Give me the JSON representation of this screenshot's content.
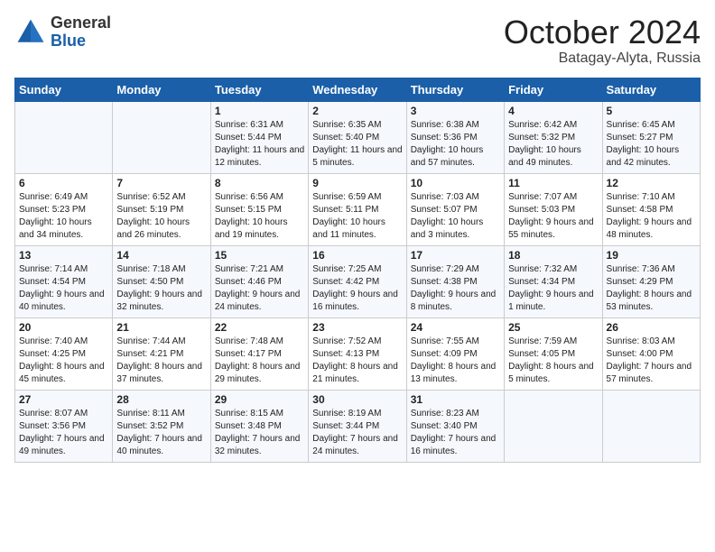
{
  "header": {
    "logo_general": "General",
    "logo_blue": "Blue",
    "month_title": "October 2024",
    "location": "Batagay-Alyta, Russia"
  },
  "weekdays": [
    "Sunday",
    "Monday",
    "Tuesday",
    "Wednesday",
    "Thursday",
    "Friday",
    "Saturday"
  ],
  "weeks": [
    [
      null,
      null,
      {
        "day": "1",
        "sunrise": "6:31 AM",
        "sunset": "5:44 PM",
        "daylight": "11 hours and 12 minutes."
      },
      {
        "day": "2",
        "sunrise": "6:35 AM",
        "sunset": "5:40 PM",
        "daylight": "11 hours and 5 minutes."
      },
      {
        "day": "3",
        "sunrise": "6:38 AM",
        "sunset": "5:36 PM",
        "daylight": "10 hours and 57 minutes."
      },
      {
        "day": "4",
        "sunrise": "6:42 AM",
        "sunset": "5:32 PM",
        "daylight": "10 hours and 49 minutes."
      },
      {
        "day": "5",
        "sunrise": "6:45 AM",
        "sunset": "5:27 PM",
        "daylight": "10 hours and 42 minutes."
      }
    ],
    [
      {
        "day": "6",
        "sunrise": "6:49 AM",
        "sunset": "5:23 PM",
        "daylight": "10 hours and 34 minutes."
      },
      {
        "day": "7",
        "sunrise": "6:52 AM",
        "sunset": "5:19 PM",
        "daylight": "10 hours and 26 minutes."
      },
      {
        "day": "8",
        "sunrise": "6:56 AM",
        "sunset": "5:15 PM",
        "daylight": "10 hours and 19 minutes."
      },
      {
        "day": "9",
        "sunrise": "6:59 AM",
        "sunset": "5:11 PM",
        "daylight": "10 hours and 11 minutes."
      },
      {
        "day": "10",
        "sunrise": "7:03 AM",
        "sunset": "5:07 PM",
        "daylight": "10 hours and 3 minutes."
      },
      {
        "day": "11",
        "sunrise": "7:07 AM",
        "sunset": "5:03 PM",
        "daylight": "9 hours and 55 minutes."
      },
      {
        "day": "12",
        "sunrise": "7:10 AM",
        "sunset": "4:58 PM",
        "daylight": "9 hours and 48 minutes."
      }
    ],
    [
      {
        "day": "13",
        "sunrise": "7:14 AM",
        "sunset": "4:54 PM",
        "daylight": "9 hours and 40 minutes."
      },
      {
        "day": "14",
        "sunrise": "7:18 AM",
        "sunset": "4:50 PM",
        "daylight": "9 hours and 32 minutes."
      },
      {
        "day": "15",
        "sunrise": "7:21 AM",
        "sunset": "4:46 PM",
        "daylight": "9 hours and 24 minutes."
      },
      {
        "day": "16",
        "sunrise": "7:25 AM",
        "sunset": "4:42 PM",
        "daylight": "9 hours and 16 minutes."
      },
      {
        "day": "17",
        "sunrise": "7:29 AM",
        "sunset": "4:38 PM",
        "daylight": "9 hours and 8 minutes."
      },
      {
        "day": "18",
        "sunrise": "7:32 AM",
        "sunset": "4:34 PM",
        "daylight": "9 hours and 1 minute."
      },
      {
        "day": "19",
        "sunrise": "7:36 AM",
        "sunset": "4:29 PM",
        "daylight": "8 hours and 53 minutes."
      }
    ],
    [
      {
        "day": "20",
        "sunrise": "7:40 AM",
        "sunset": "4:25 PM",
        "daylight": "8 hours and 45 minutes."
      },
      {
        "day": "21",
        "sunrise": "7:44 AM",
        "sunset": "4:21 PM",
        "daylight": "8 hours and 37 minutes."
      },
      {
        "day": "22",
        "sunrise": "7:48 AM",
        "sunset": "4:17 PM",
        "daylight": "8 hours and 29 minutes."
      },
      {
        "day": "23",
        "sunrise": "7:52 AM",
        "sunset": "4:13 PM",
        "daylight": "8 hours and 21 minutes."
      },
      {
        "day": "24",
        "sunrise": "7:55 AM",
        "sunset": "4:09 PM",
        "daylight": "8 hours and 13 minutes."
      },
      {
        "day": "25",
        "sunrise": "7:59 AM",
        "sunset": "4:05 PM",
        "daylight": "8 hours and 5 minutes."
      },
      {
        "day": "26",
        "sunrise": "8:03 AM",
        "sunset": "4:00 PM",
        "daylight": "7 hours and 57 minutes."
      }
    ],
    [
      {
        "day": "27",
        "sunrise": "8:07 AM",
        "sunset": "3:56 PM",
        "daylight": "7 hours and 49 minutes."
      },
      {
        "day": "28",
        "sunrise": "8:11 AM",
        "sunset": "3:52 PM",
        "daylight": "7 hours and 40 minutes."
      },
      {
        "day": "29",
        "sunrise": "8:15 AM",
        "sunset": "3:48 PM",
        "daylight": "7 hours and 32 minutes."
      },
      {
        "day": "30",
        "sunrise": "8:19 AM",
        "sunset": "3:44 PM",
        "daylight": "7 hours and 24 minutes."
      },
      {
        "day": "31",
        "sunrise": "8:23 AM",
        "sunset": "3:40 PM",
        "daylight": "7 hours and 16 minutes."
      },
      null,
      null
    ]
  ]
}
